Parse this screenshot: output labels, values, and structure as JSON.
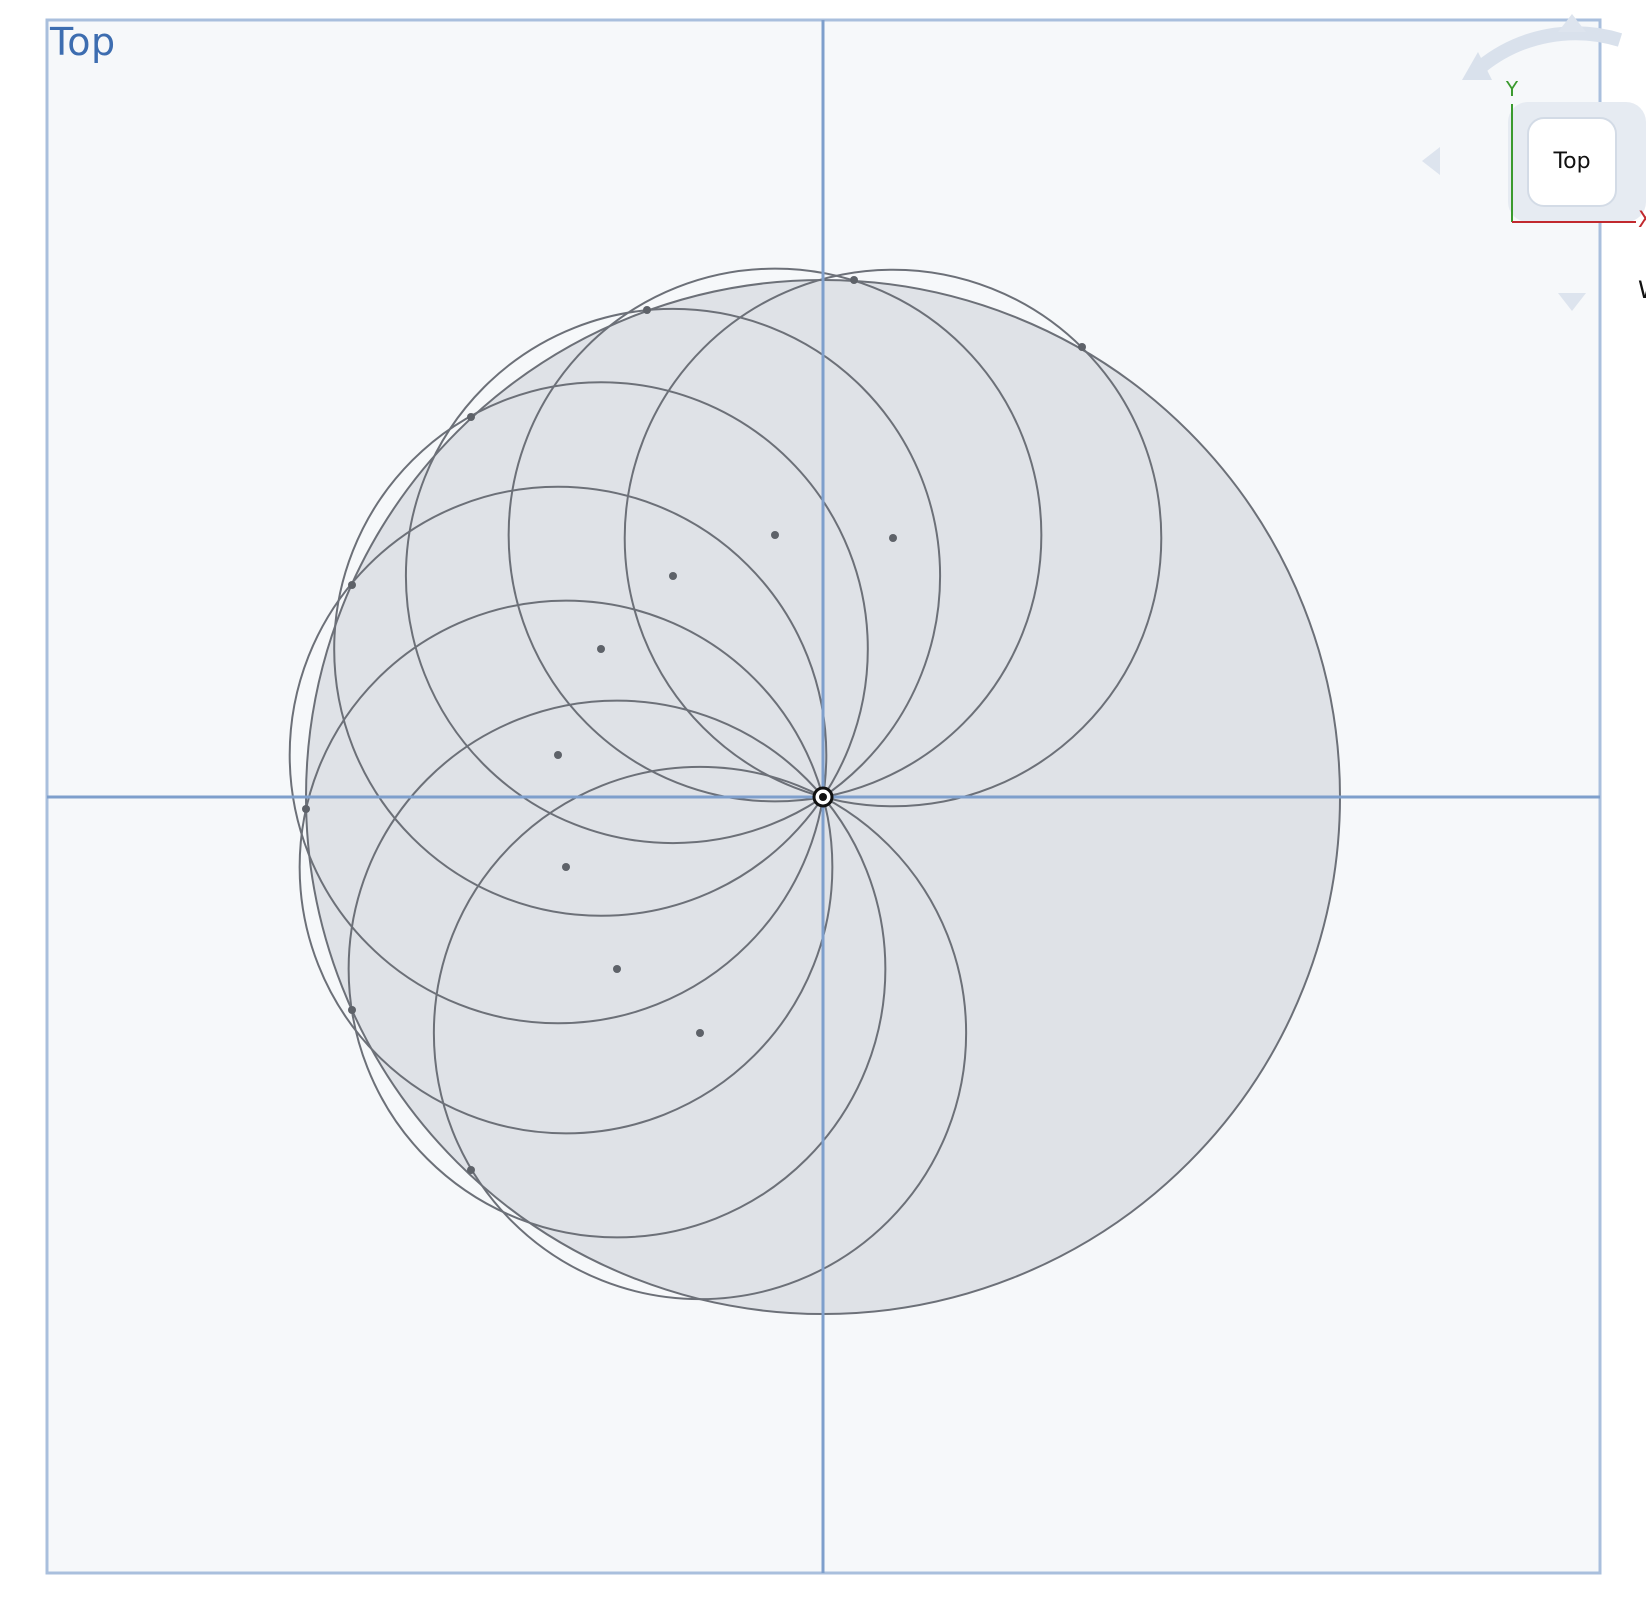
{
  "viewport": {
    "view_name": "Top"
  },
  "viewcube": {
    "face_label": "Top",
    "axis_y_label": "Y",
    "axis_x_label": "X",
    "edge_hint_label": "W",
    "axis_y_color": "#3a9a2e",
    "axis_x_color": "#c1292e"
  },
  "colors": {
    "canvas_background": "#f6f8fa",
    "frame_and_axes": "#7e9fcc",
    "view_label": "#3d6db0",
    "shape_fill": "#dfe2e7",
    "shape_stroke": "#6c7078",
    "point_color": "#5e6269"
  },
  "icons": {
    "origin_marker": "origin-point-icon",
    "viewcube_rotate": "rotate-arrow-icon",
    "viewcube_nav_up": "triangle-up-icon",
    "viewcube_nav_down": "triangle-down-icon",
    "viewcube_nav_left": "triangle-left-icon"
  },
  "sketch": {
    "main_circle_count": 1,
    "arc_circle_count": 8,
    "center_point_count": 8,
    "endpoint_count": 8
  }
}
